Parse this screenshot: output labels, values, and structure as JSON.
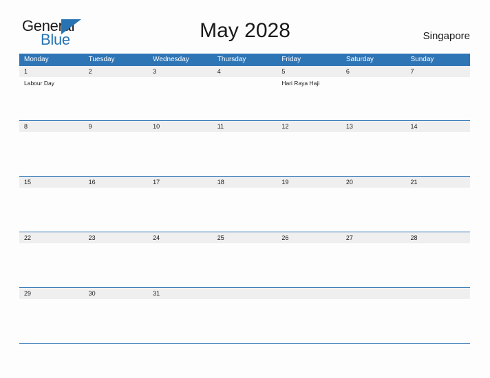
{
  "brand": {
    "name_part1": "General",
    "name_part2": "Blue",
    "triangle_icon": "triangle-icon",
    "color_primary": "#2874b2",
    "color_text": "#1a1a1a"
  },
  "header": {
    "title": "May 2028",
    "location": "Singapore"
  },
  "theme": {
    "header_blue": "#2e75b6",
    "date_band_gray": "#efefef",
    "page_background": "#fdfdfd",
    "rule_blue": "#2e75b6"
  },
  "calendar": {
    "month": "May",
    "year": "2028",
    "weekday_headers": [
      "Monday",
      "Tuesday",
      "Wednesday",
      "Thursday",
      "Friday",
      "Saturday",
      "Sunday"
    ],
    "weeks": [
      {
        "days": [
          {
            "num": "1",
            "events": [
              "Labour Day"
            ]
          },
          {
            "num": "2",
            "events": []
          },
          {
            "num": "3",
            "events": []
          },
          {
            "num": "4",
            "events": []
          },
          {
            "num": "5",
            "events": [
              "Hari Raya Haji"
            ]
          },
          {
            "num": "6",
            "events": []
          },
          {
            "num": "7",
            "events": []
          }
        ]
      },
      {
        "days": [
          {
            "num": "8",
            "events": []
          },
          {
            "num": "9",
            "events": []
          },
          {
            "num": "10",
            "events": []
          },
          {
            "num": "11",
            "events": []
          },
          {
            "num": "12",
            "events": []
          },
          {
            "num": "13",
            "events": []
          },
          {
            "num": "14",
            "events": []
          }
        ]
      },
      {
        "days": [
          {
            "num": "15",
            "events": []
          },
          {
            "num": "16",
            "events": []
          },
          {
            "num": "17",
            "events": []
          },
          {
            "num": "18",
            "events": []
          },
          {
            "num": "19",
            "events": []
          },
          {
            "num": "20",
            "events": []
          },
          {
            "num": "21",
            "events": []
          }
        ]
      },
      {
        "days": [
          {
            "num": "22",
            "events": []
          },
          {
            "num": "23",
            "events": []
          },
          {
            "num": "24",
            "events": []
          },
          {
            "num": "25",
            "events": []
          },
          {
            "num": "26",
            "events": []
          },
          {
            "num": "27",
            "events": []
          },
          {
            "num": "28",
            "events": []
          }
        ]
      },
      {
        "days": [
          {
            "num": "29",
            "events": []
          },
          {
            "num": "30",
            "events": []
          },
          {
            "num": "31",
            "events": []
          },
          {
            "num": "",
            "events": []
          },
          {
            "num": "",
            "events": []
          },
          {
            "num": "",
            "events": []
          },
          {
            "num": "",
            "events": []
          }
        ]
      }
    ]
  }
}
